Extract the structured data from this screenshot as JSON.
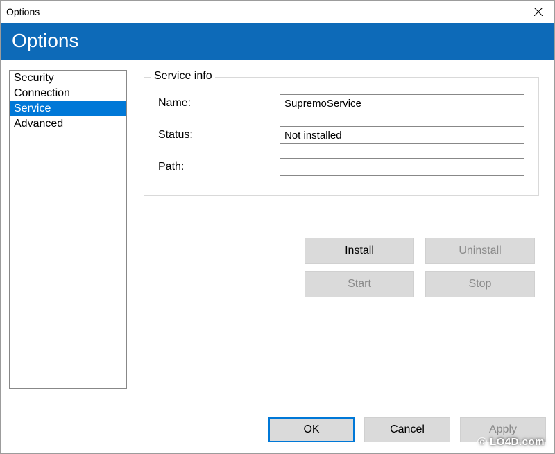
{
  "window": {
    "title": "Options",
    "banner": "Options"
  },
  "sidebar": {
    "items": [
      {
        "label": "Security",
        "selected": false
      },
      {
        "label": "Connection",
        "selected": false
      },
      {
        "label": "Service",
        "selected": true
      },
      {
        "label": "Advanced",
        "selected": false
      }
    ]
  },
  "serviceInfo": {
    "legend": "Service info",
    "nameLabel": "Name:",
    "nameValue": "SupremoService",
    "statusLabel": "Status:",
    "statusValue": "Not installed",
    "pathLabel": "Path:",
    "pathValue": ""
  },
  "actions": {
    "install": "Install",
    "uninstall": "Uninstall",
    "start": "Start",
    "stop": "Stop"
  },
  "dialog": {
    "ok": "OK",
    "cancel": "Cancel",
    "apply": "Apply"
  },
  "watermark": "LO4D.com"
}
